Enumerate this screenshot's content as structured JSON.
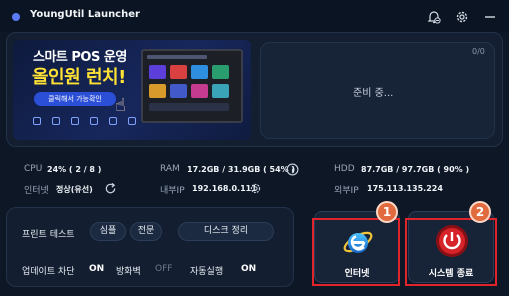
{
  "window": {
    "title": "YoungUtil Launcher",
    "icons": [
      "bell-off-icon",
      "gear-icon",
      "minimize-icon"
    ],
    "accent": "#5b7cf7"
  },
  "banner": {
    "line1": "스마트 POS 운영",
    "line2": "올인원 런치!",
    "cta": "클릭해서 가능확인"
  },
  "status_panel": {
    "count": "0/0",
    "text": "준비 중..."
  },
  "system_info": {
    "cpu": {
      "label": "CPU",
      "value": "24% ( 2 / 8 )"
    },
    "ram": {
      "label": "RAM",
      "value": "17.2GB / 31.9GB ( 54% )"
    },
    "hdd": {
      "label": "HDD",
      "value": "87.7GB / 97.7GB ( 90% )"
    },
    "internet": {
      "label": "인터넷",
      "value": "정상(유선)"
    },
    "internal_ip": {
      "label": "내부IP",
      "value": "192.168.0.111"
    },
    "external_ip": {
      "label": "외부IP",
      "value": "175.113.135.224"
    }
  },
  "tools": {
    "print_test": {
      "label": "프린트 테스트",
      "buttons": [
        "심플",
        "전문",
        "디스크 정리"
      ]
    },
    "toggles": {
      "update_block": {
        "label": "업데이트 차단",
        "state": "ON"
      },
      "firewall": {
        "label": "방화벽",
        "state": "OFF"
      },
      "autorun": {
        "label": "자동실행",
        "state": "ON"
      }
    }
  },
  "actions": {
    "internet": {
      "label": "인터넷",
      "badge": "1"
    },
    "shutdown": {
      "label": "시스템 종료",
      "badge": "2"
    },
    "highlight_color": "#e0242b",
    "badge_color": "#e16a3e"
  }
}
